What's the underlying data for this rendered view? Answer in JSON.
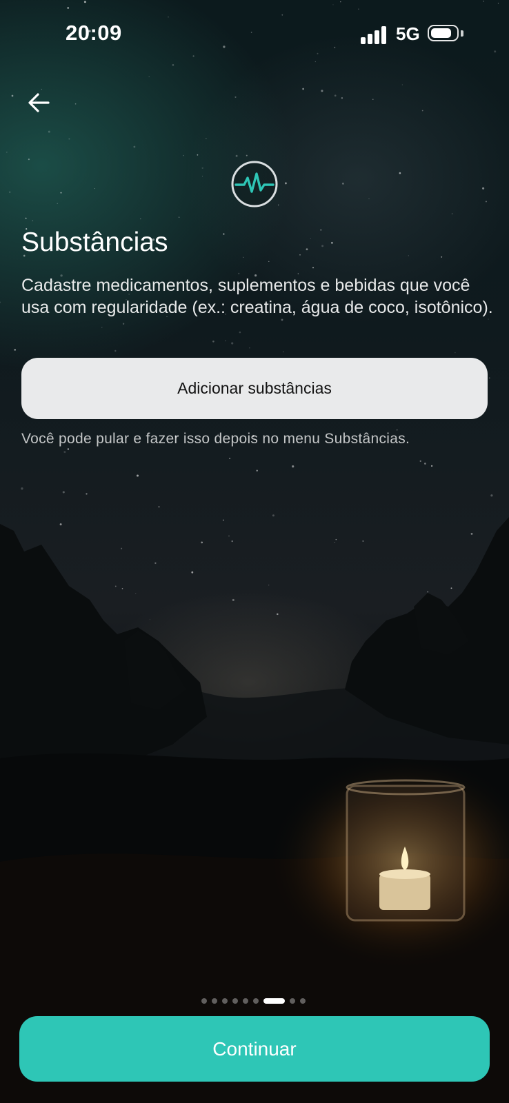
{
  "status_bar": {
    "time": "20:09",
    "network": "5G"
  },
  "icons": {
    "back": "arrow-left-icon",
    "header": "heartbeat-pulse-icon"
  },
  "onboarding": {
    "title": "Substâncias",
    "description": "Cadastre medicamentos, suplementos e bebidas que você usa com regularidade (ex.: creatina, água de coco, isotônico).",
    "add_button_label": "Adicionar substâncias",
    "hint": "Você pode pular e fazer isso depois no menu Substâncias."
  },
  "pagination": {
    "total_steps": 9,
    "current_step": 7
  },
  "footer": {
    "continue_label": "Continuar"
  },
  "colors": {
    "accent": "#2ec6b6",
    "secondary_button": "#e9eaeb"
  }
}
